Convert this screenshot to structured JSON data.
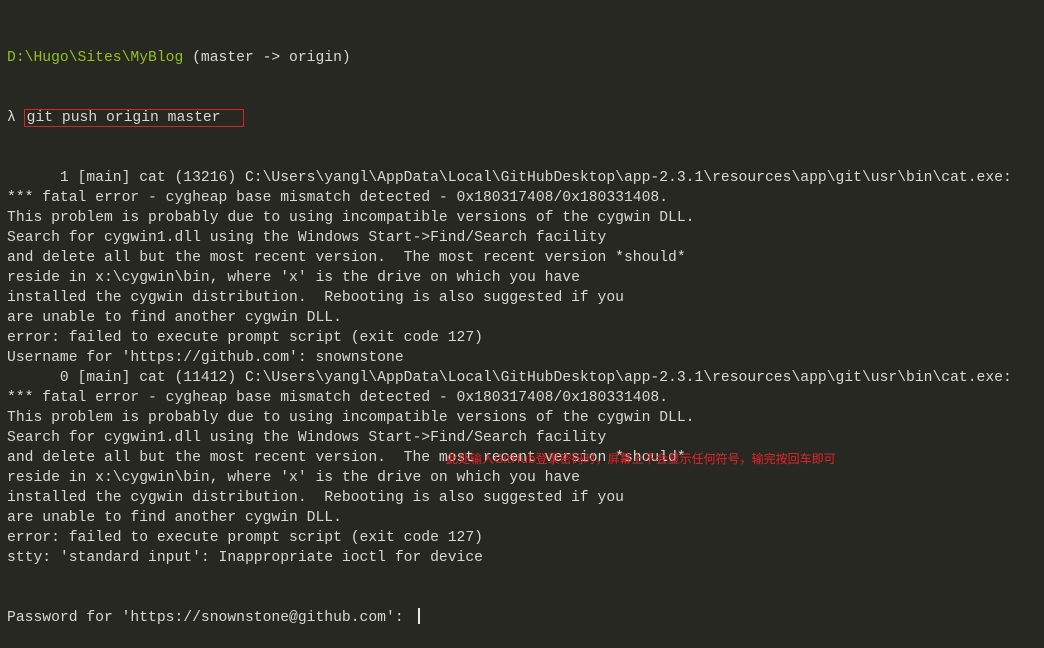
{
  "prompt": {
    "path": "D:\\Hugo\\Sites\\MyBlog",
    "branch": " (master -> origin)",
    "symbol": "λ",
    "command": "git push origin master"
  },
  "output": [
    "      1 [main] cat (13216) C:\\Users\\yangl\\AppData\\Local\\GitHubDesktop\\app-2.3.1\\resources\\app\\git\\usr\\bin\\cat.exe:",
    "*** fatal error - cygheap base mismatch detected - 0x180317408/0x180331408.",
    "This problem is probably due to using incompatible versions of the cygwin DLL.",
    "Search for cygwin1.dll using the Windows Start->Find/Search facility",
    "and delete all but the most recent version.  The most recent version *should*",
    "reside in x:\\cygwin\\bin, where 'x' is the drive on which you have",
    "installed the cygwin distribution.  Rebooting is also suggested if you",
    "are unable to find another cygwin DLL.",
    "error: failed to execute prompt script (exit code 127)",
    "Username for 'https://github.com': snownstone",
    "      0 [main] cat (11412) C:\\Users\\yangl\\AppData\\Local\\GitHubDesktop\\app-2.3.1\\resources\\app\\git\\usr\\bin\\cat.exe:",
    "*** fatal error - cygheap base mismatch detected - 0x180317408/0x180331408.",
    "This problem is probably due to using incompatible versions of the cygwin DLL.",
    "Search for cygwin1.dll using the Windows Start->Find/Search facility",
    "and delete all but the most recent version.  The most recent version *should*",
    "reside in x:\\cygwin\\bin, where 'x' is the drive on which you have",
    "installed the cygwin distribution.  Rebooting is also suggested if you",
    "are unable to find another cygwin DLL.",
    "error: failed to execute prompt script (exit code 127)",
    "stty: 'standard input': Inappropriate ioctl for device"
  ],
  "password_prompt": "Password for 'https://snownstone@github.com': ",
  "annotation": "此处输入GitHub登录密码时，屏幕上不会显示任何符号，输完按回车即可",
  "colors": {
    "background": "#272822",
    "text": "#d8d8d2",
    "path": "#8fc21f",
    "annotation": "#e8232a"
  }
}
